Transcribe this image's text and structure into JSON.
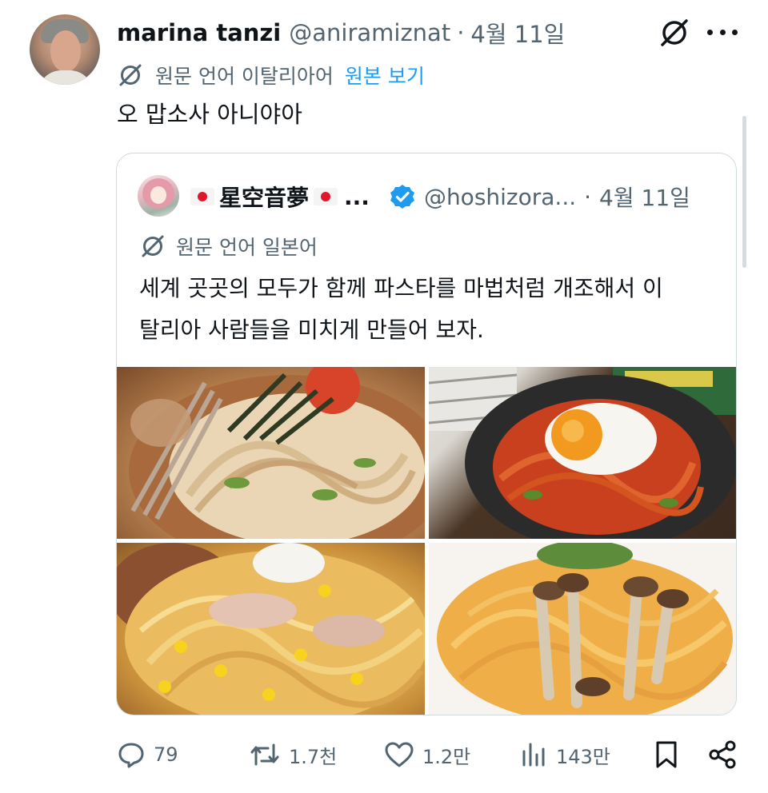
{
  "author": {
    "name": "marina tanzi",
    "handle": "@aniramiznat",
    "separator": "·",
    "time": "4월 11일"
  },
  "translation": {
    "note": "원문 언어 이탈리아어",
    "show_original": "원본 보기"
  },
  "tweet_text": "오 맙소사 아니야아",
  "quote": {
    "name": "星空音夢",
    "ellipsis": "...",
    "handle": "@hoshizora...",
    "separator": "·",
    "time": "4월 11일",
    "translation_note": "원문 언어 일본어",
    "text_lines": [
      "세계 곳곳의 모두가 함께 파스타를 마법처럼 개조해서 이",
      "탈리아 사람들을 미치게 만들어 보자."
    ],
    "verified_color": "#1d9bf0",
    "flag_color": "#e0162b"
  },
  "actions": {
    "replies": "79",
    "reposts": "1.7천",
    "likes": "1.2만",
    "views": "143만"
  },
  "icons": {
    "grok": "grok-icon",
    "more": "more-icon",
    "translate": "translate-icon",
    "verified": "verified-badge-icon",
    "reply": "reply-icon",
    "repost": "repost-icon",
    "like": "like-icon",
    "views": "views-icon",
    "bookmark": "bookmark-icon",
    "share": "share-icon"
  },
  "colors": {
    "text": "#0f1419",
    "secondary": "#536471",
    "accent": "#1d9bf0",
    "border": "#cfd9de"
  }
}
